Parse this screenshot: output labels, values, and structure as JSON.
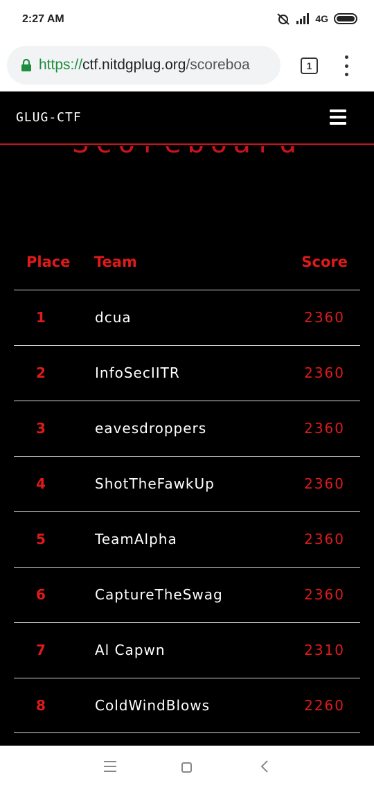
{
  "status_bar": {
    "time": "2:27 AM",
    "network": "4G"
  },
  "browser": {
    "url_scheme": "https://",
    "url_host": "ctf.nitdgplug.org",
    "url_path": "/scoreboa",
    "tab_count": "1"
  },
  "site": {
    "brand": "GLUG-CTF",
    "heading": "Scoreboard",
    "accent_color": "#e01a1a"
  },
  "scoreboard": {
    "headers": {
      "place": "Place",
      "team": "Team",
      "score": "Score"
    },
    "rows": [
      {
        "place": "1",
        "team": "dcua",
        "score": "2360"
      },
      {
        "place": "2",
        "team": "InfoSecIITR",
        "score": "2360"
      },
      {
        "place": "3",
        "team": "eavesdroppers",
        "score": "2360"
      },
      {
        "place": "4",
        "team": "ShotTheFawkUp",
        "score": "2360"
      },
      {
        "place": "5",
        "team": "TeamAlpha",
        "score": "2360"
      },
      {
        "place": "6",
        "team": "CaptureTheSwag",
        "score": "2360"
      },
      {
        "place": "7",
        "team": "Al Capwn",
        "score": "2310"
      },
      {
        "place": "8",
        "team": "ColdWindBlows",
        "score": "2260"
      }
    ]
  },
  "icons": {
    "lock": "lock-icon",
    "menu": "hamburger-icon",
    "overflow": "more-vert-icon"
  }
}
